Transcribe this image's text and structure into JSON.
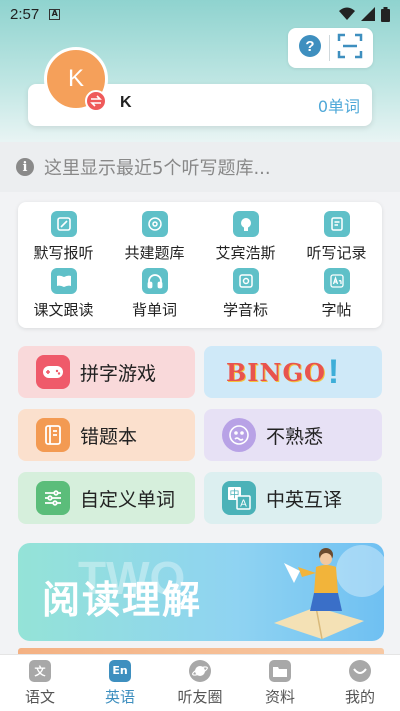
{
  "status_bar": {
    "time": "2:57",
    "notif_badge": "A"
  },
  "profile": {
    "avatar_letter": "K",
    "name": "K",
    "word_count": "0单词"
  },
  "notice": {
    "icon_glyph": "i",
    "text": "这里显示最近5个听写题库..."
  },
  "tools": [
    {
      "label": "默写报听",
      "icon": "pencil-icon"
    },
    {
      "label": "共建题库",
      "icon": "share-icon"
    },
    {
      "label": "艾宾浩斯",
      "icon": "brain-icon"
    },
    {
      "label": "听写记录",
      "icon": "document-icon"
    },
    {
      "label": "课文跟读",
      "icon": "book-icon"
    },
    {
      "label": "背单词",
      "icon": "headphones-icon"
    },
    {
      "label": "学音标",
      "icon": "phonetic-icon"
    },
    {
      "label": "字帖",
      "icon": "aa-icon"
    }
  ],
  "functions": {
    "spelling_game": "拼字游戏",
    "bingo": "BINGO",
    "bingo_mark": "!",
    "wrong_book": "错题本",
    "unfamiliar": "不熟悉",
    "custom_words": "自定义单词",
    "translate": "中英互译",
    "translate_icon_zh": "中",
    "translate_icon_en": "A"
  },
  "banner": {
    "watermark": "TWO",
    "title": "阅读理解"
  },
  "tabbar": [
    {
      "label": "语文",
      "glyph": "文",
      "active": false
    },
    {
      "label": "英语",
      "glyph": "En",
      "active": true
    },
    {
      "label": "听友圈",
      "glyph": "",
      "active": false
    },
    {
      "label": "资料",
      "glyph": "",
      "active": false
    },
    {
      "label": "我的",
      "glyph": "",
      "active": false
    }
  ],
  "colors": {
    "accent": "#3e8fbf",
    "tool_icon": "#5fc0c8",
    "spelling_bg": "#f9d9da",
    "bingo_bg": "#cfe9f8",
    "wrong_bg": "#fbe0cd",
    "unfamiliar_bg": "#e7e1f5",
    "custom_bg": "#d6efdc",
    "translate_bg": "#dceff0"
  }
}
